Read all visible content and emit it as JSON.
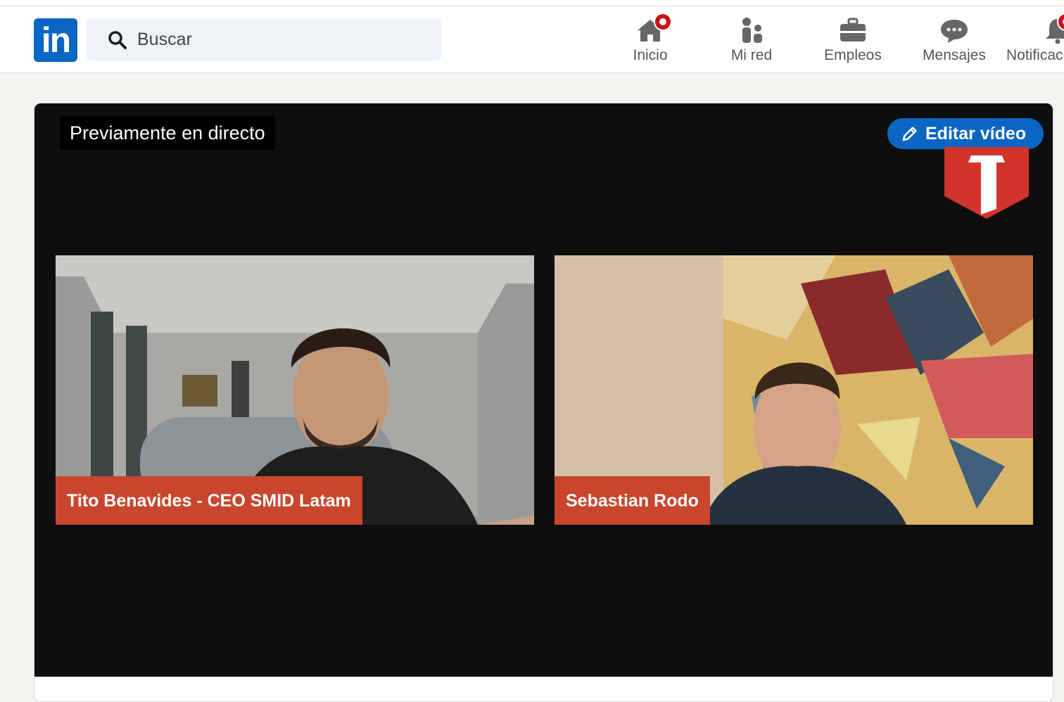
{
  "navbar": {
    "logo_text": "in",
    "search": {
      "placeholder": "Buscar",
      "value": ""
    },
    "items": [
      {
        "label": "Inicio",
        "icon": "home-icon",
        "badge": true
      },
      {
        "label": "Mi red",
        "icon": "network-icon",
        "badge": false
      },
      {
        "label": "Empleos",
        "icon": "briefcase-icon",
        "badge": false
      },
      {
        "label": "Mensajes",
        "icon": "messaging-icon",
        "badge": false
      },
      {
        "label": "Notificac",
        "icon": "bell-icon",
        "badge": true
      }
    ]
  },
  "video": {
    "status_label": "Previamente en directo",
    "edit_button_label": "Editar vídeo",
    "participants": [
      {
        "name_tag": "Tito Benavides - CEO SMID Latam"
      },
      {
        "name_tag": "Sebastian Rodo"
      }
    ]
  },
  "colors": {
    "accent": "#0a66c2",
    "badge": "#cc1016",
    "name_tag": "#c8462d",
    "video_bg": "#0e0e0e"
  }
}
